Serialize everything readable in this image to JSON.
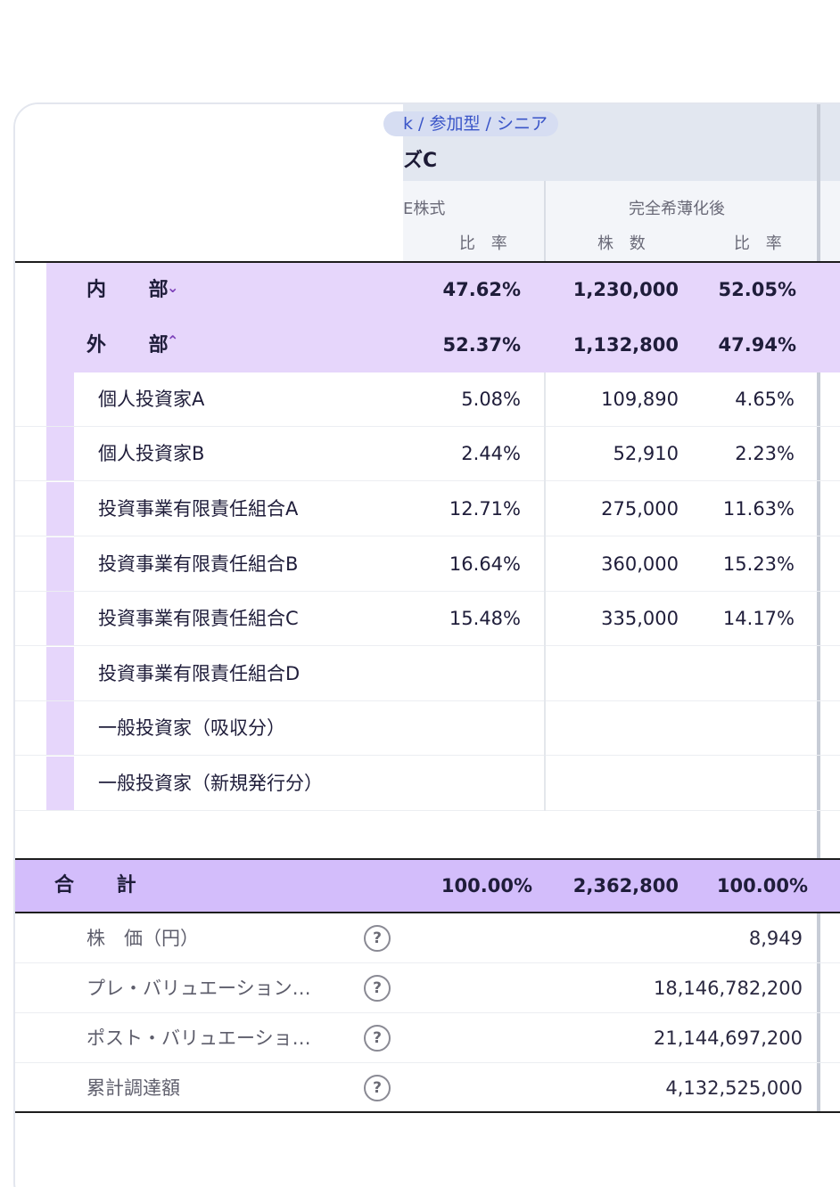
{
  "header": {
    "series_chip": "k / 参加型 / シニア",
    "series_title": "ズC",
    "col_group_left": "E株式",
    "col_group_right": "完全希薄化後",
    "sub_ratio_left": "比 率",
    "sub_shares": "株 数",
    "sub_ratio_right": "比 率"
  },
  "groups": [
    {
      "label": "内 部",
      "toggle": "chevron-down-icon",
      "ratio": "47.62%",
      "shares": "1,230,000",
      "diluted_ratio": "52.05%"
    },
    {
      "label": "外 部",
      "toggle": "chevron-up-icon",
      "ratio": "52.37%",
      "shares": "1,132,800",
      "diluted_ratio": "47.94%"
    }
  ],
  "rows": [
    {
      "name": "個人投資家A",
      "ratio": "5.08%",
      "shares": "109,890",
      "diluted_ratio": "4.65%"
    },
    {
      "name": "個人投資家B",
      "ratio": "2.44%",
      "shares": "52,910",
      "diluted_ratio": "2.23%"
    },
    {
      "name": "投資事業有限責任組合A",
      "ratio": "12.71%",
      "shares": "275,000",
      "diluted_ratio": "11.63%"
    },
    {
      "name": "投資事業有限責任組合B",
      "ratio": "16.64%",
      "shares": "360,000",
      "diluted_ratio": "15.23%"
    },
    {
      "name": "投資事業有限責任組合C",
      "ratio": "15.48%",
      "shares": "335,000",
      "diluted_ratio": "14.17%"
    },
    {
      "name": "投資事業有限責任組合D",
      "ratio": "",
      "shares": "",
      "diluted_ratio": ""
    },
    {
      "name": "一般投資家（吸収分）",
      "ratio": "",
      "shares": "",
      "diluted_ratio": ""
    },
    {
      "name": "一般投資家（新規発行分）",
      "ratio": "",
      "shares": "",
      "diluted_ratio": ""
    }
  ],
  "total": {
    "label": "合 計",
    "ratio": "100.00%",
    "shares": "2,362,800",
    "diluted_ratio": "100.00%"
  },
  "metrics": [
    {
      "label": "株　価（円）",
      "value": "8,949",
      "help": "?"
    },
    {
      "label": "プレ・バリュエーション…",
      "value": "18,146,782,200",
      "help": "?"
    },
    {
      "label": "ポスト・バリュエーショ…",
      "value": "21,144,697,200",
      "help": "?"
    },
    {
      "label": "累計調達額",
      "value": "4,132,525,000",
      "help": "?"
    }
  ],
  "colors": {
    "group_bg": "#e6d6fb",
    "total_bg": "#d3bdfb",
    "accent": "#7b3fb8"
  }
}
